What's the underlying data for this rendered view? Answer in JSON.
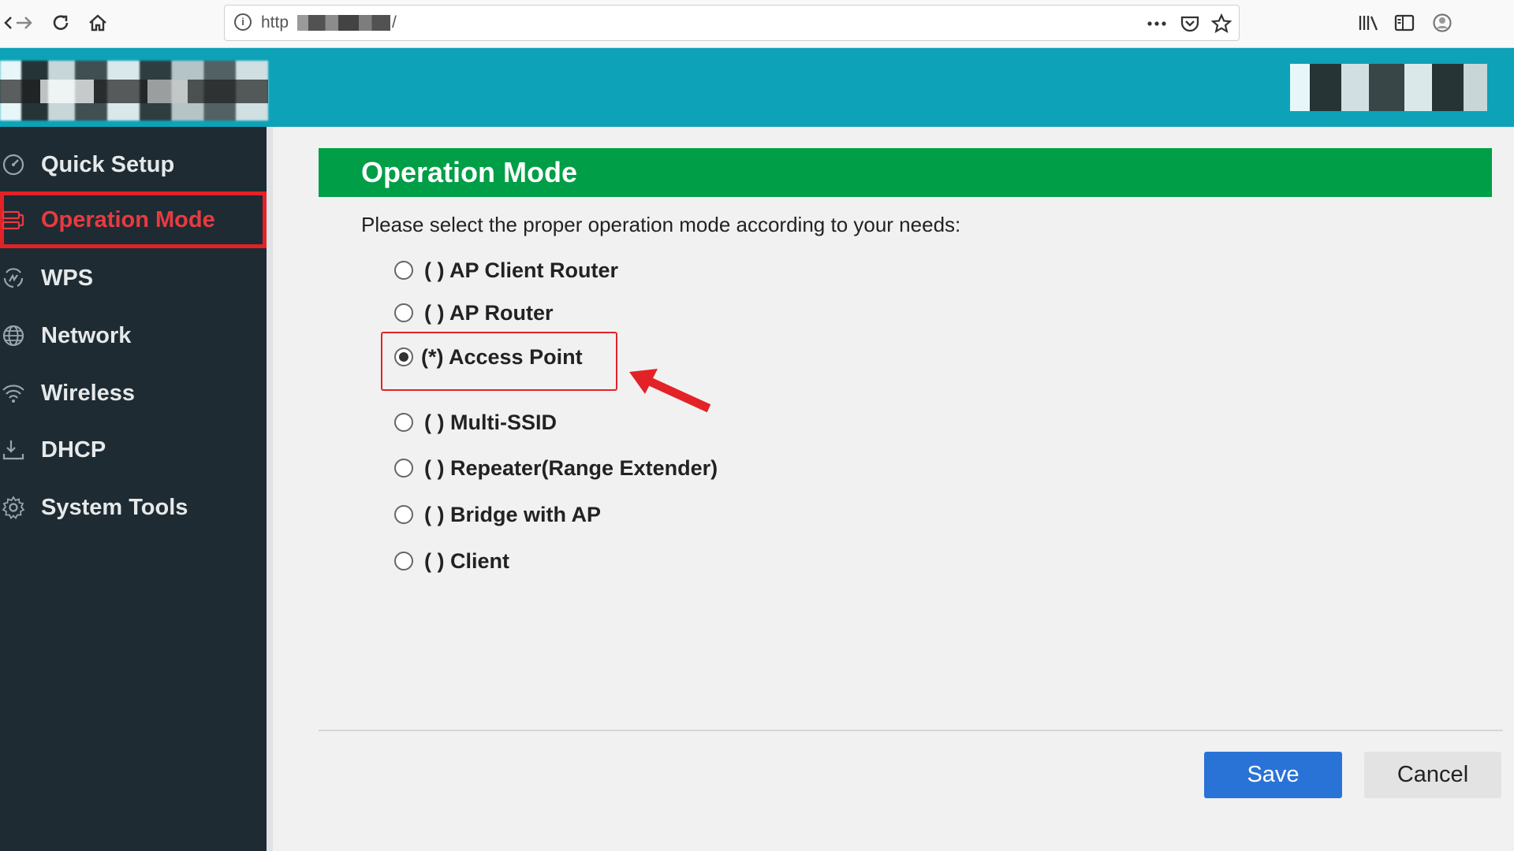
{
  "browser": {
    "url_prefix": "http",
    "url_suffix": "/",
    "icons": {
      "back": "arrow-left-icon",
      "forward": "arrow-right-icon",
      "reload": "reload-icon",
      "home": "home-icon",
      "info": "info-icon",
      "more": "more-dots-icon",
      "pocket": "pocket-icon",
      "bookmark": "star-icon",
      "library": "library-icon",
      "sidebar": "sidebar-icon",
      "account": "account-icon"
    }
  },
  "sidebar": {
    "items": [
      {
        "label": "Quick Setup",
        "icon": "gauge-icon"
      },
      {
        "label": "Operation Mode",
        "icon": "router-icon",
        "active": true
      },
      {
        "label": "WPS",
        "icon": "wps-icon"
      },
      {
        "label": "Network",
        "icon": "globe-icon"
      },
      {
        "label": "Wireless",
        "icon": "wifi-icon"
      },
      {
        "label": "DHCP",
        "icon": "download-icon"
      },
      {
        "label": "System Tools",
        "icon": "gear-icon"
      }
    ]
  },
  "panel": {
    "title": "Operation Mode",
    "intro": "Please select the proper operation mode according to your needs:",
    "modes": [
      {
        "label": "( ) AP Client Router",
        "checked": false
      },
      {
        "label": "( ) AP Router",
        "checked": false
      },
      {
        "label": "(*) Access Point",
        "checked": true
      },
      {
        "label": "( ) Multi-SSID",
        "checked": false
      },
      {
        "label": "( ) Repeater(Range Extender)",
        "checked": false
      },
      {
        "label": "( ) Bridge with AP",
        "checked": false
      },
      {
        "label": "( ) Client",
        "checked": false
      }
    ]
  },
  "actions": {
    "save": "Save",
    "cancel": "Cancel"
  },
  "colors": {
    "header": "#0ea2b8",
    "sidebar": "#1e2b33",
    "title_bar": "#009e46",
    "active": "#e32228",
    "save_button": "#2a73d6"
  }
}
